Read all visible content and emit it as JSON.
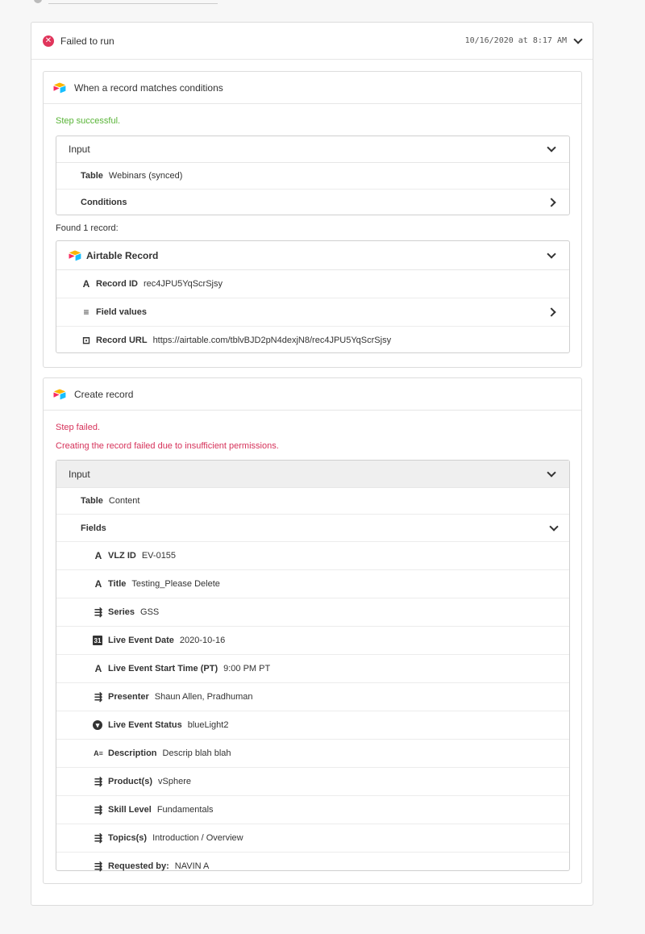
{
  "run": {
    "status": "Failed to run",
    "timestamp": "10/16/2020 at 8:17 AM"
  },
  "trigger": {
    "title": "When a record matches conditions",
    "status": "Step successful.",
    "input": {
      "header": "Input",
      "table_label": "Table",
      "table_value": "Webinars (synced)",
      "conditions_label": "Conditions"
    },
    "found_text": "Found 1 record:",
    "record": {
      "header": "Airtable Record",
      "id_label": "Record ID",
      "id_value": "rec4JPU5YqScrSjsy",
      "fields_label": "Field values",
      "url_label": "Record URL",
      "url_value": "https://airtable.com/tblvBJD2pN4dexjN8/rec4JPU5YqScrSjsy"
    }
  },
  "action": {
    "title": "Create record",
    "status": "Step failed.",
    "error": "Creating the record failed due to insufficient permissions.",
    "input": {
      "header": "Input",
      "table_label": "Table",
      "table_value": "Content",
      "fields_header": "Fields"
    },
    "fields": [
      {
        "icon": "text-icon",
        "glyph": "A",
        "label": "VLZ ID",
        "value": "EV-0155"
      },
      {
        "icon": "text-icon",
        "glyph": "A",
        "label": "Title",
        "value": "Testing_Please Delete"
      },
      {
        "icon": "link-list-icon",
        "glyph": "⇶",
        "label": "Series",
        "value": "GSS"
      },
      {
        "icon": "calendar-icon",
        "glyph": "31",
        "label": "Live Event Date",
        "value": "2020-10-16"
      },
      {
        "icon": "text-icon",
        "glyph": "A",
        "label": "Live Event Start Time (PT)",
        "value": "9:00 PM PT"
      },
      {
        "icon": "link-list-icon",
        "glyph": "⇶",
        "label": "Presenter",
        "value": "Shaun Allen, Pradhuman"
      },
      {
        "icon": "single-select-icon",
        "glyph": "▾",
        "label": "Live Event Status",
        "value": "blueLight2"
      },
      {
        "icon": "long-text-icon",
        "glyph": "A≡",
        "label": "Description",
        "value": "Descrip blah blah"
      },
      {
        "icon": "link-list-icon",
        "glyph": "⇶",
        "label": "Product(s)",
        "value": "vSphere"
      },
      {
        "icon": "link-list-icon",
        "glyph": "⇶",
        "label": "Skill Level",
        "value": "Fundamentals"
      },
      {
        "icon": "link-list-icon",
        "glyph": "⇶",
        "label": "Topics(s)",
        "value": "Introduction / Overview"
      },
      {
        "icon": "link-list-icon",
        "glyph": "⇶",
        "label": "Requested by:",
        "value": "NAVIN A"
      }
    ]
  },
  "colors": {
    "success": "#58b436",
    "failure": "#d6325a",
    "border": "#dcdcdc"
  }
}
